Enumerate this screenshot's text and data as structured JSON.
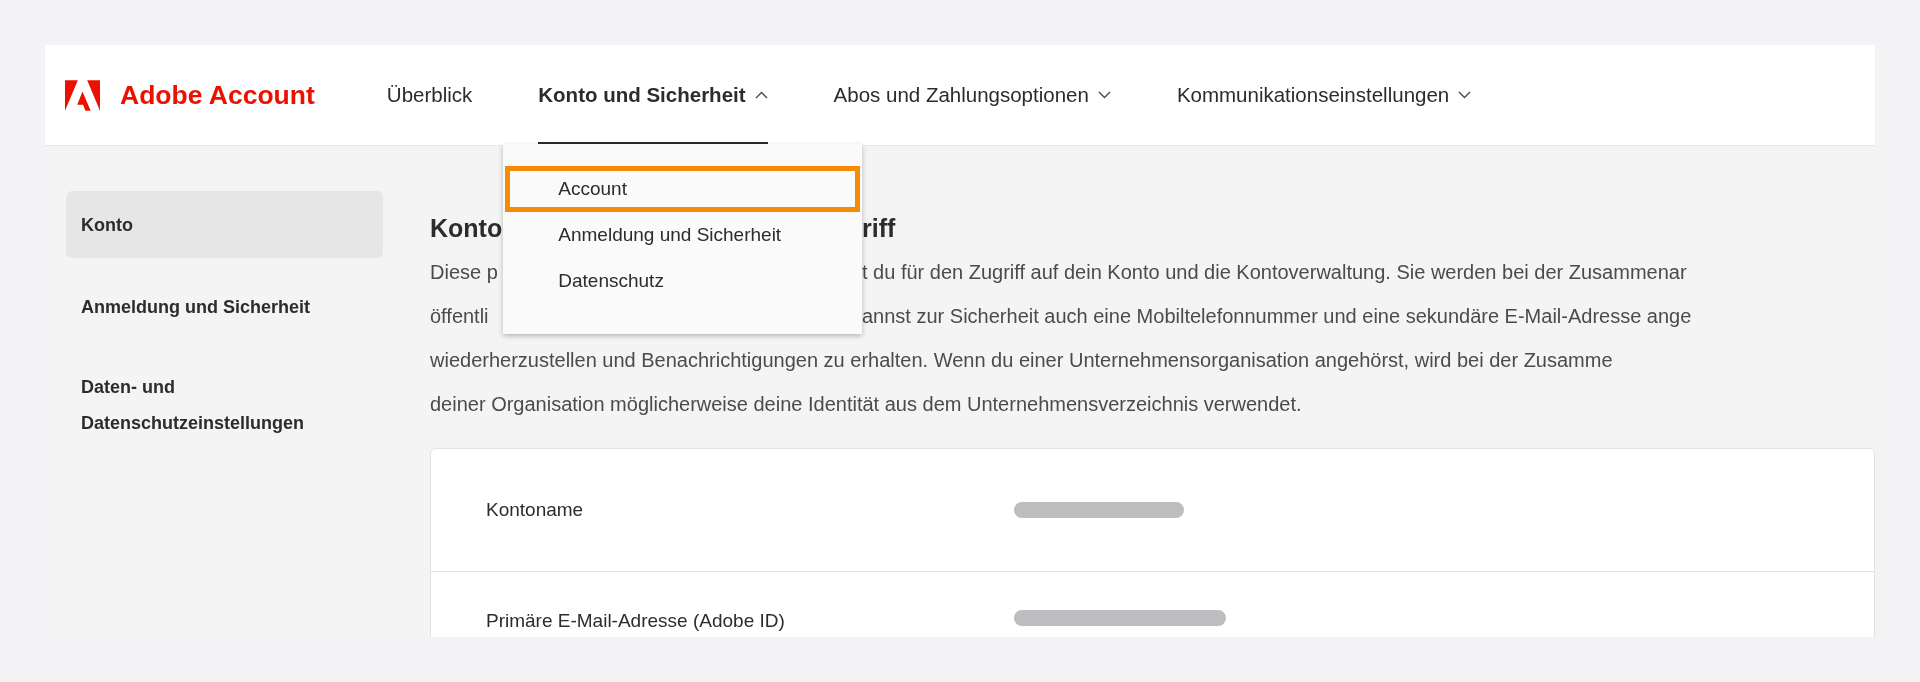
{
  "brand": {
    "name": "Adobe Account"
  },
  "nav": [
    {
      "label": "Überblick",
      "selected": false,
      "has_menu": false
    },
    {
      "label": "Konto und Sicherheit",
      "selected": true,
      "has_menu": true,
      "expanded": true,
      "menu": [
        {
          "label": "Account",
          "highlighted": true
        },
        {
          "label": "Anmeldung und Sicherheit",
          "highlighted": false
        },
        {
          "label": "Datenschutz",
          "highlighted": false
        }
      ]
    },
    {
      "label": "Abos und Zahlungsoptionen",
      "selected": false,
      "has_menu": true,
      "expanded": false
    },
    {
      "label": "Kommunikationseinstellungen",
      "selected": false,
      "has_menu": true,
      "expanded": false
    }
  ],
  "sidebar": {
    "items": [
      {
        "label": "Konto",
        "selected": true
      },
      {
        "label": "Anmeldung und Sicherheit",
        "selected": false
      },
      {
        "label": "Daten- und Datenschutzeinstellungen",
        "selected": false
      }
    ]
  },
  "section": {
    "heading": {
      "left": "Konto",
      "right": "riff"
    },
    "lines": [
      {
        "left": "Diese p",
        "right": "t du für den Zugriff auf dein Konto und die Kontoverwaltung. Sie werden bei der Zusammenar"
      },
      {
        "left": "öffentli",
        "right": "annst zur Sicherheit auch eine Mobiltelefonnummer und eine sekundäre E-Mail-Adresse ange"
      },
      {
        "left": "wiederherzustellen und Benachrichtigungen zu erhalten. Wenn du einer Unternehmensorganisation angehörst, wird bei der Zusamme"
      },
      {
        "left": "deiner Organisation möglicherweise deine Identität aus dem Unternehmensverzeichnis verwendet."
      }
    ]
  },
  "card": {
    "rows": [
      {
        "label": "Kontoname",
        "value_hidden": true
      },
      {
        "label": "Primäre E-Mail-Adresse (Adobe ID)",
        "value_hidden": true
      }
    ]
  }
}
